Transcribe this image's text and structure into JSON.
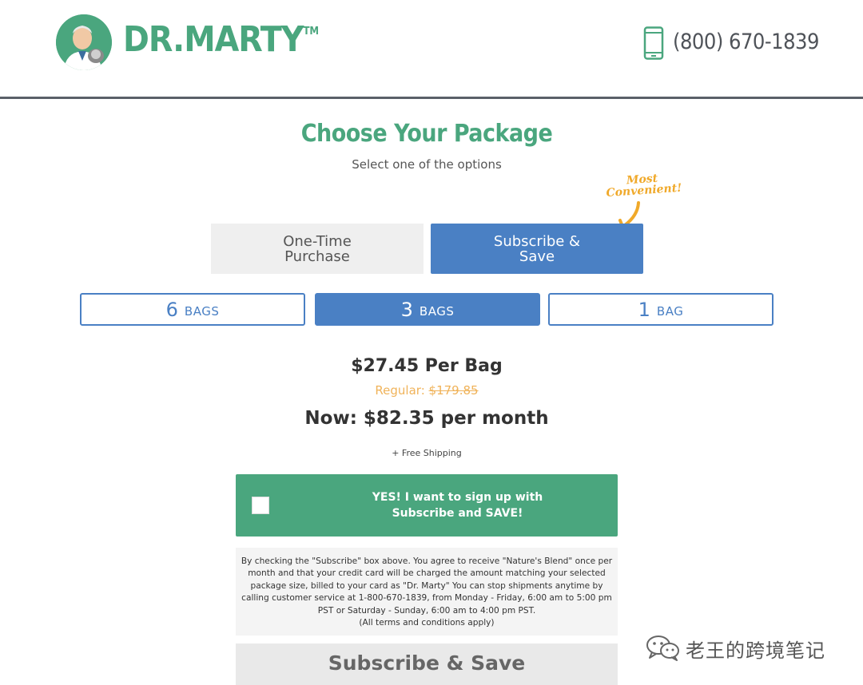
{
  "header": {
    "logo_text": "DR.MARTY",
    "logo_tm": "TM",
    "phone": "(800) 670-1839"
  },
  "main": {
    "title": "Choose Your Package",
    "subtitle": "Select one of the options",
    "badge_note": "Most Convenient!",
    "purchase_tabs": [
      {
        "label": "One-Time Purchase",
        "selected": false
      },
      {
        "label": "Subscribe & Save",
        "selected": true
      }
    ],
    "quantities": [
      {
        "number": "6",
        "unit": "BAGS",
        "selected": false
      },
      {
        "number": "3",
        "unit": "BAGS",
        "selected": true
      },
      {
        "number": "1",
        "unit": "BAG",
        "selected": false
      }
    ],
    "pricing": {
      "per_bag": "$27.45 Per Bag",
      "regular_label": "Regular:",
      "regular_price": "$179.85",
      "now": "Now: $82.35 per month",
      "shipping": "+ Free Shipping"
    },
    "subscribe": {
      "checked": false,
      "line1": "YES! I want to sign up with",
      "line2": "Subscribe and SAVE!"
    },
    "terms": {
      "text": "By checking the \"Subscribe\" box above. You agree to receive \"Nature's Blend\" once per month and that your credit card will be charged the amount matching your selected package size, billed to your card as \"Dr. Marty\" You can stop shipments anytime by calling customer service at 1-800-670-1839, from Monday - Friday, 6:00 am to 5:00 pm PST or Saturday - Sunday, 6:00 am to 4:00 pm PST.",
      "note": "(All terms and conditions apply)"
    },
    "submit_label": "Subscribe & Save"
  },
  "watermark": "老王的跨境笔记",
  "colors": {
    "brand_green": "#4aa67e",
    "accent_blue": "#4a80c4",
    "orange": "#f0a92a"
  }
}
